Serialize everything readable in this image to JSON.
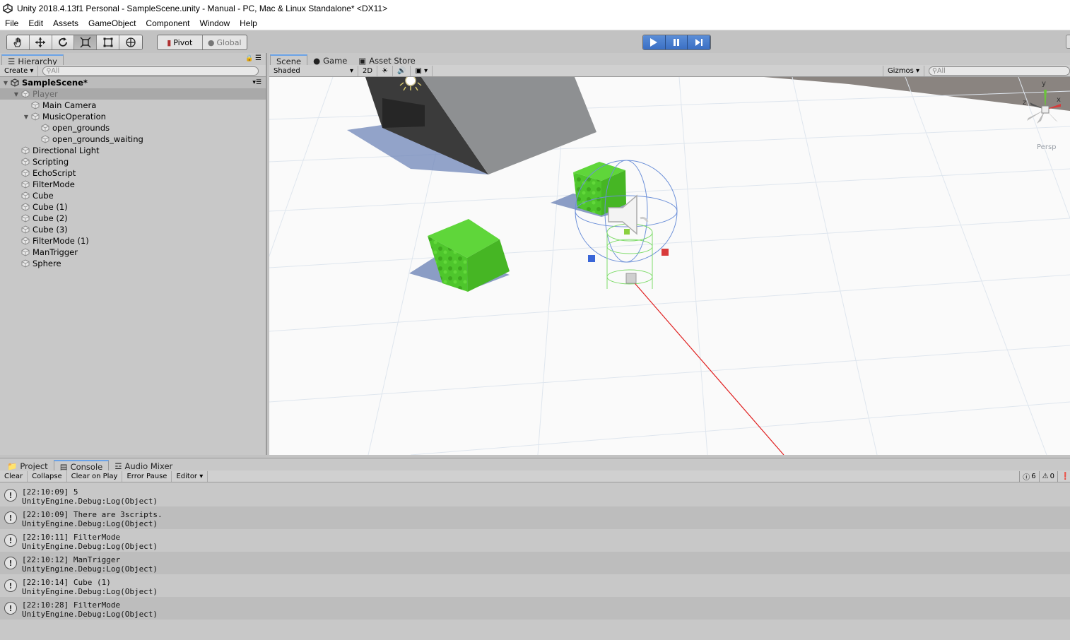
{
  "window": {
    "title": "Unity 2018.4.13f1 Personal - SampleScene.unity - Manual - PC, Mac & Linux Standalone* <DX11>"
  },
  "menu": [
    "File",
    "Edit",
    "Assets",
    "GameObject",
    "Component",
    "Window",
    "Help"
  ],
  "toolbar": {
    "pivot": "Pivot",
    "global": "Global"
  },
  "hierarchy": {
    "tab": "Hierarchy",
    "create": "Create",
    "search_placeholder": "All",
    "scene_name": "SampleScene*",
    "items": [
      {
        "label": "Player",
        "depth": 0,
        "expanded": true,
        "selected": true
      },
      {
        "label": "Main Camera",
        "depth": 1
      },
      {
        "label": "MusicOperation",
        "depth": 1,
        "expanded": true
      },
      {
        "label": "open_grounds",
        "depth": 2
      },
      {
        "label": "open_grounds_waiting",
        "depth": 2
      },
      {
        "label": "Directional Light",
        "depth": 0
      },
      {
        "label": "Scripting",
        "depth": 0
      },
      {
        "label": "EchoScript",
        "depth": 0
      },
      {
        "label": "FilterMode",
        "depth": 0
      },
      {
        "label": "Cube",
        "depth": 0
      },
      {
        "label": "Cube (1)",
        "depth": 0
      },
      {
        "label": "Cube (2)",
        "depth": 0
      },
      {
        "label": "Cube (3)",
        "depth": 0
      },
      {
        "label": "FilterMode (1)",
        "depth": 0
      },
      {
        "label": "ManTrigger",
        "depth": 0
      },
      {
        "label": "Sphere",
        "depth": 0
      }
    ]
  },
  "scene": {
    "tabs": [
      "Scene",
      "Game",
      "Asset Store"
    ],
    "shading": "Shaded",
    "mode2d": "2D",
    "gizmos": "Gizmos",
    "search_placeholder": "All",
    "persp": "Persp",
    "axes": {
      "x": "x",
      "y": "y",
      "z": "z"
    }
  },
  "console": {
    "tabs": [
      "Project",
      "Console",
      "Audio Mixer"
    ],
    "buttons": [
      "Clear",
      "Collapse",
      "Clear on Play",
      "Error Pause",
      "Editor"
    ],
    "counts": {
      "info": "6",
      "warn": "0"
    },
    "logs": [
      {
        "line1": "[22:10:09] 5",
        "line2": "UnityEngine.Debug:Log(Object)"
      },
      {
        "line1": "[22:10:09] There are 3scripts.",
        "line2": "UnityEngine.Debug:Log(Object)"
      },
      {
        "line1": "[22:10:11] FilterMode",
        "line2": "UnityEngine.Debug:Log(Object)"
      },
      {
        "line1": "[22:10:12] ManTrigger",
        "line2": "UnityEngine.Debug:Log(Object)"
      },
      {
        "line1": "[22:10:14] Cube (1)",
        "line2": "UnityEngine.Debug:Log(Object)"
      },
      {
        "line1": "[22:10:28] FilterMode",
        "line2": "UnityEngine.Debug:Log(Object)"
      }
    ]
  }
}
